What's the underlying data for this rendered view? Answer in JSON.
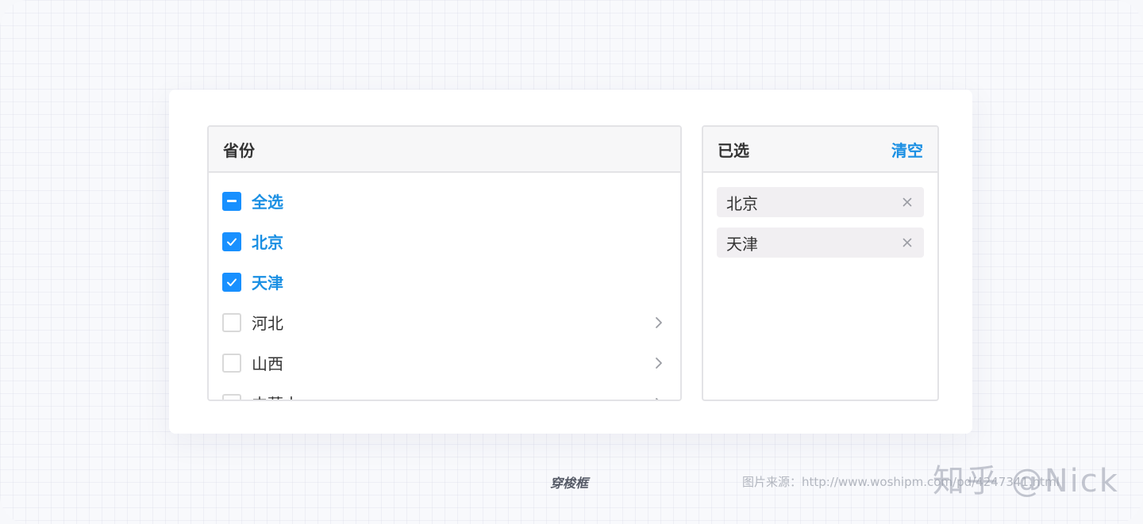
{
  "left_panel": {
    "title": "省份",
    "items": [
      {
        "label": "全选",
        "state": "indeterminate",
        "has_children": false
      },
      {
        "label": "北京",
        "state": "checked",
        "has_children": false
      },
      {
        "label": "天津",
        "state": "checked",
        "has_children": false
      },
      {
        "label": "河北",
        "state": "unchecked",
        "has_children": true
      },
      {
        "label": "山西",
        "state": "unchecked",
        "has_children": true
      },
      {
        "label": "内蒙古",
        "state": "unchecked",
        "has_children": true
      }
    ]
  },
  "right_panel": {
    "title": "已选",
    "clear_label": "清空",
    "selected": [
      {
        "label": "北京"
      },
      {
        "label": "天津"
      }
    ]
  },
  "caption": "穿梭框",
  "source_text": "图片来源：http://www.woshipm.com/pd/4247341.html",
  "watermark": "知乎 @Nick",
  "colors": {
    "accent": "#1890ff",
    "accent_text": "#1a8fe3",
    "border": "#e3e3e6",
    "tag_bg": "#f1eff2"
  },
  "icons": {
    "checkbox_checked": "check-icon",
    "checkbox_indeterminate": "minus-icon",
    "expand": "chevron-right-icon",
    "remove": "close-icon"
  }
}
